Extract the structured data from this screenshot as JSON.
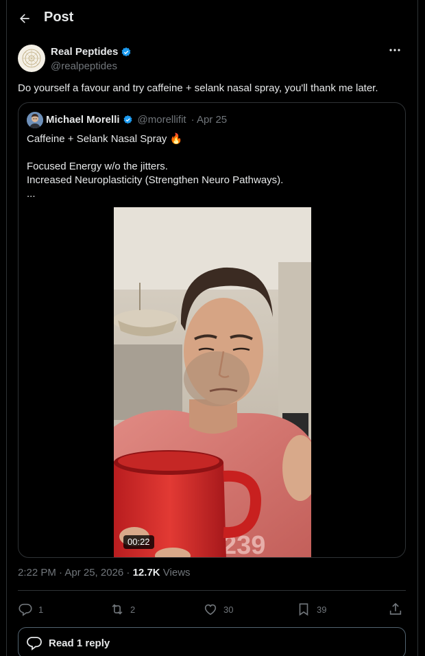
{
  "header": {
    "title": "Post"
  },
  "post": {
    "author_name": "Real Peptides",
    "author_handle": "@realpeptides",
    "text": "Do yourself a favour and try caffeine + selank nasal spray, you'll thank me later.",
    "timestamp": "2:22 PM · Apr 25, 2026 · ",
    "views_count": "12.7K",
    "views_label": " Views"
  },
  "quoted": {
    "author_name": "Michael Morelli",
    "author_handle": "@morellifit",
    "date": "· Apr 25",
    "lines": [
      "Caffeine + Selank Nasal Spray 🔥",
      "",
      "Focused Energy w/o the jitters.",
      "Increased Neuroplasticity (Strengthen Neuro Pathways).",
      "..."
    ],
    "video_duration": "00:22"
  },
  "actions": {
    "replies": "1",
    "reposts": "2",
    "likes": "30",
    "bookmarks": "39"
  },
  "read_replies_label": "Read 1 reply",
  "colors": {
    "background": "#000000",
    "text": "#e7e9ea",
    "muted": "#71767b",
    "border": "#2f3336",
    "verified": "#1d9bf0"
  }
}
